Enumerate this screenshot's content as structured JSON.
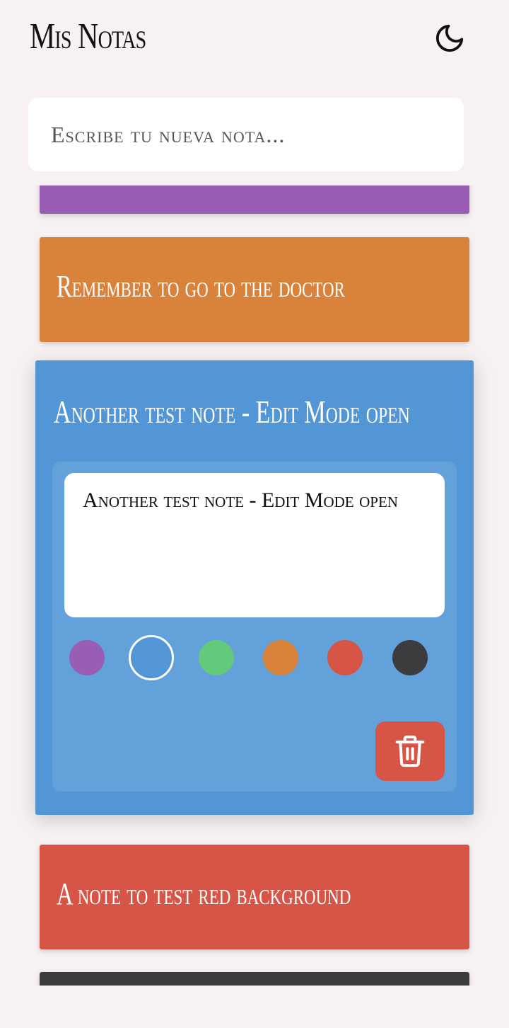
{
  "header": {
    "title": "Mis Notas",
    "theme_icon": "moon-icon"
  },
  "new_note": {
    "placeholder": "Escribe tu nueva nota..."
  },
  "notes": [
    {
      "text": "",
      "color": "#9a5db4"
    },
    {
      "text": "Remember to go to the doctor",
      "color": "#d9823b"
    },
    {
      "text": "Another test note - Edit Mode open",
      "color": "#5396d6",
      "editing": true
    },
    {
      "text": "A note to test red background",
      "color": "#d65547"
    },
    {
      "text": "",
      "color": "#3c3c3e"
    }
  ],
  "editor": {
    "value": "Another test note - Edit Mode open",
    "colors": [
      "#9a5db4",
      "#5396d6",
      "#63c97b",
      "#d9823b",
      "#d65547",
      "#3c3c3e"
    ],
    "selected_color": "#5396d6",
    "delete_icon": "trash-icon"
  }
}
